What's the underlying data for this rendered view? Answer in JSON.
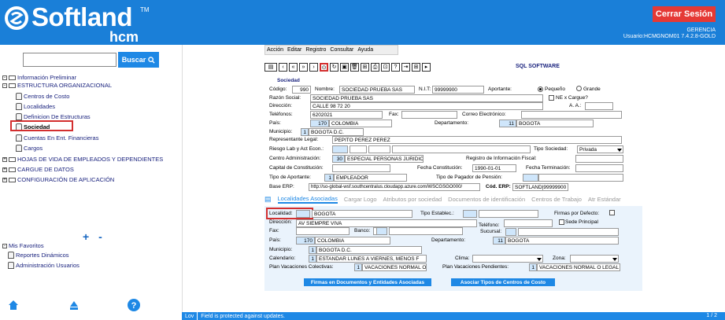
{
  "header": {
    "brand": "Softland",
    "brand_sub": "hcm",
    "trademark": "TM",
    "logout_label": "Cerrar Sesión",
    "company": "GERENCIA",
    "user_version": "Usuario:HCMGNOM01 7.4.2.8-GOLD"
  },
  "sidebar": {
    "search_placeholder": "",
    "search_label": "Buscar",
    "root_label": "Información Preliminar",
    "section1": "ESTRUCTURA ORGANIZACIONAL",
    "items": [
      "Centros de Costo",
      "Localidades",
      "Definicion De Estructuras",
      "Sociedad",
      "Cuentas En Ent. Financieras",
      "Cargos"
    ],
    "sections": [
      "HOJAS DE VIDA DE EMPLEADOS Y DEPENDIENTES",
      "CARGUE DE DATOS",
      "CONFIGURACIÓN DE APLICACIÓN"
    ],
    "favorites_label": "Mis Favoritos",
    "favorites": [
      "Reportes Dinámicos",
      "Administración Usuarios"
    ],
    "plus_minus": "+ -"
  },
  "menu": [
    "Acción",
    "Editar",
    "Registro",
    "Consultar",
    "Ayuda"
  ],
  "company_banner": "SQL SOFTWARE",
  "form": {
    "title": "Sociedad",
    "codigo_label": "Código:",
    "codigo": "990",
    "nombre_label": "Nombre:",
    "nombre": "SOCIEDAD  PRUEBA SAS",
    "nit_label": "N.I.T:",
    "nit": "99999900",
    "aportante_label": "Aportante:",
    "pequeno": "Pequeño",
    "grande": "Grande",
    "razon_label": "Razón Social:",
    "razon": "SOCIEDAD  PRUEBA SAS",
    "ne_cargue": "NE x Cargue?",
    "direccion_label": "Dirección:",
    "direccion": "CALLE 98 72 20",
    "aa_label": "A. A.:",
    "telefonos_label": "Teléfonos:",
    "telefonos": "6202021",
    "fax_label": "Fax:",
    "correo_label": "Correo Electrónico:",
    "pais_label": "País:",
    "pais_cod": "170",
    "pais": "COLOMBIA",
    "departamento_label": "Departamento:",
    "dep_cod": "11",
    "departamento": "BOGOTA",
    "municipio_label": "Municipio:",
    "mun_cod": "1",
    "municipio": "BOGOTA D.C.",
    "representante_label": "Representante Legal:",
    "representante": "PEPITO PEREZ PEREZ",
    "riesgo_label": "Riesgo Lab y Act Econ.:",
    "tipo_soc_label": "Tipo Sociedad:",
    "tipo_soc": "Privada",
    "centro_adm_label": "Centro Administración:",
    "centro_cod": "30",
    "centro_adm": "ESPECIAL PERSONAS JURIDICAS",
    "registro_fiscal_label": "Registro de Información Fiscal:",
    "capital_label": "Capital de Constitución:",
    "fecha_const_label": "Fecha Constitución:",
    "fecha_const": "1990-01-01",
    "fecha_term_label": "Fecha Terminación:",
    "tipo_aport_label": "Tipo de Aportante:",
    "tipo_aport_cod": "1",
    "tipo_aport": "EMPLEADOR",
    "tipo_pagador_label": "Tipo de Pagador de Pensión:",
    "base_erp_label": "Base ERP:",
    "base_erp": "http://so-global-wsf.southcentralus.cloudapp.azure.com/WSCGSGO000/",
    "cod_erp_label": "Cód. ERP:",
    "cod_erp": "SOFTLAND|99999900"
  },
  "tabs": [
    "Localidades Asociadas",
    "Cargar Logo",
    "Atributos por sociedad",
    "Documentos de identificación",
    "Centros de Trabajo",
    "Atr Estándar"
  ],
  "detail": {
    "localidad_label": "Localidad:",
    "localidad": "BOGOTA",
    "tipo_estab_label": "Tipo Establec.:",
    "firmas_def_label": "Firmas por Defecto:",
    "direccion_label": "Dirección:",
    "direccion": "AV SIEMPRE VIVA",
    "telefono_label": "Teléfono:",
    "sede_label": "Sede Principal",
    "fax_label": "Fax:",
    "banco_label": "Banco:",
    "sucursal_label": "Sucursal:",
    "pais_label": "País:",
    "pais_cod": "170",
    "pais": "COLOMBIA",
    "departamento_label": "Departamento:",
    "dep_cod": "11",
    "departamento": "BOGOTA",
    "municipio_label": "Municipio:",
    "mun_cod": "1",
    "municipio": "BOGOTA D.C.",
    "calendario_label": "Calendario:",
    "cal_cod": "1",
    "calendario": "ESTANDAR LUNES A VIERNES, MENOS F",
    "clima_label": "Clima:",
    "zona_label": "Zona:",
    "plan_col_label": "Plan Vacaciones Colectivas:",
    "plan_col_cod": "1",
    "plan_col": "VACACIONES NORMAL O LEGAL",
    "plan_pen_label": "Plan Vacaciones Pendientes:",
    "plan_pen_cod": "1",
    "plan_pen": "VACACIONES NORMAL O LEGAL",
    "btn_firmas": "Firmas en Documentos y Entidades Asociadas",
    "btn_asociar": "Asociar Tipos de Centros de Costo"
  },
  "status": {
    "mode": "Lov",
    "message": "Field is protected against updates.",
    "page": "1 / 2"
  }
}
